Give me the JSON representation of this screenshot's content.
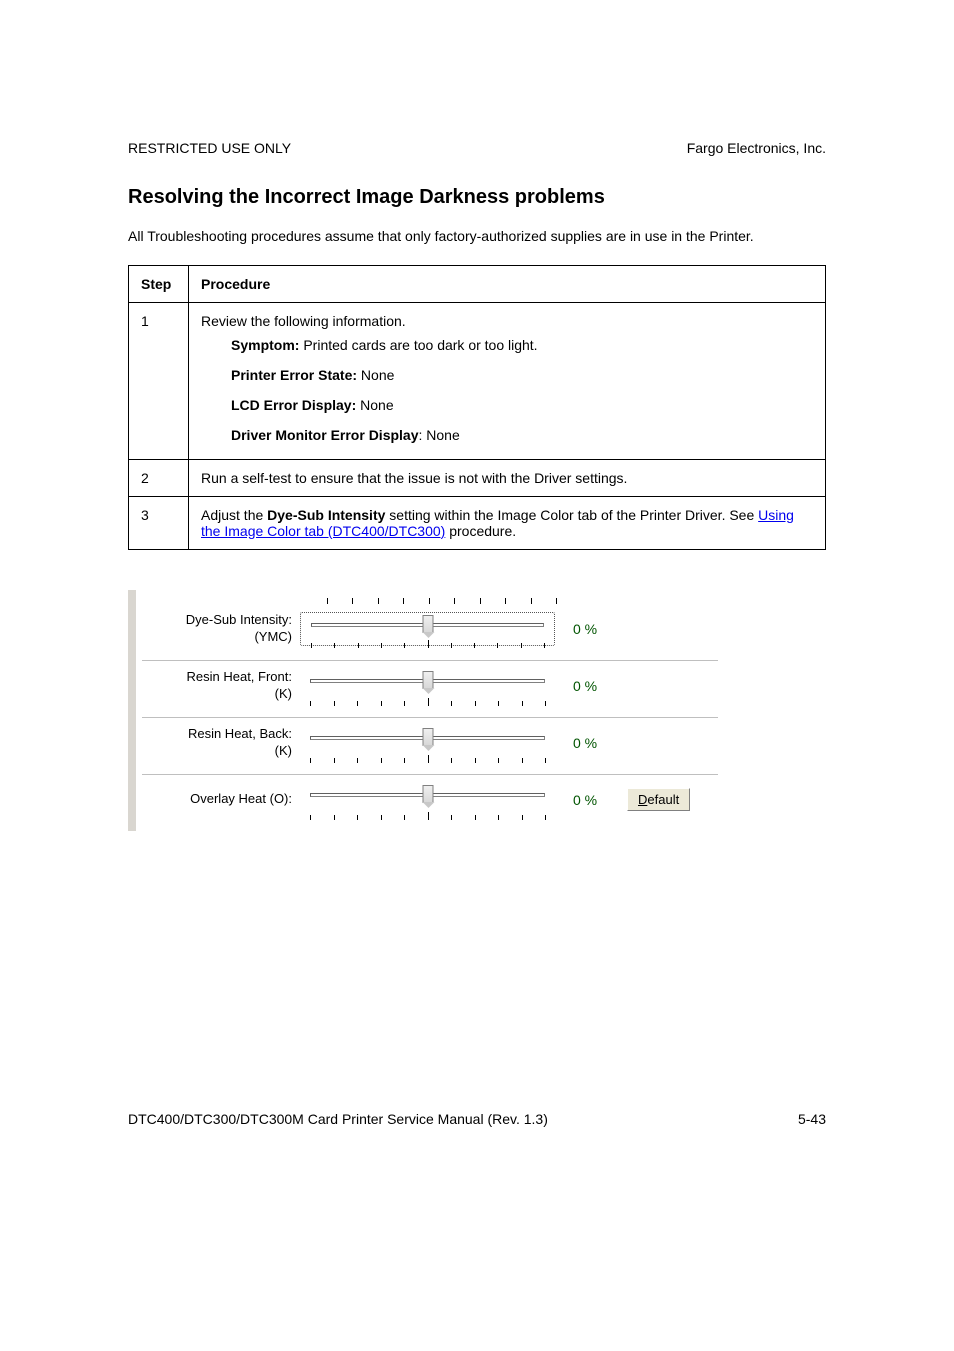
{
  "header": {
    "left": "RESTRICTED USE ONLY",
    "right": "Fargo Electronics, Inc."
  },
  "title": "Resolving the Incorrect Image Darkness problems",
  "intro": "All Troubleshooting procedures assume that only factory-authorized supplies are in use in the Printer.",
  "table": {
    "head_step": "Step",
    "head_proc": "Procedure",
    "rows": [
      {
        "step": "1",
        "lines": {
          "review": "Review the following information.",
          "symptom_label": "Symptom:",
          "symptom_text": " Printed cards are too dark or too light.",
          "pes_label": "Printer Error State:",
          "pes_text": " None",
          "lcd_label": "LCD Error Display:",
          "lcd_text": " None",
          "dme_label": "Driver Monitor Error Display",
          "dme_text": ": None"
        }
      },
      {
        "step": "2",
        "text": "Run a self-test to ensure that the issue is not with the Driver settings."
      },
      {
        "step": "3",
        "prefix": "Adjust the ",
        "bold": "Dye-Sub Intensity",
        "mid": " setting within the Image Color tab of the Printer Driver. See ",
        "link": "Using the Image Color tab (DTC400/DTC300)",
        "suffix": " procedure."
      }
    ]
  },
  "panel": {
    "rows": [
      {
        "label_top": "Dye-Sub Intensity:",
        "label_bot": "(YMC)",
        "value": "0 %"
      },
      {
        "label_top": "Resin Heat, Front:",
        "label_bot": "(K)",
        "value": "0 %"
      },
      {
        "label_top": "Resin Heat, Back:",
        "label_bot": "(K)",
        "value": "0 %"
      },
      {
        "label_top": "Overlay Heat  (O):",
        "label_bot": "",
        "value": "0 %"
      }
    ],
    "default_btn_u": "D",
    "default_btn_rest": "efault"
  },
  "footer": {
    "left": "DTC400/DTC300/DTC300M Card Printer Service Manual (Rev. 1.3)",
    "right": "5-43"
  }
}
